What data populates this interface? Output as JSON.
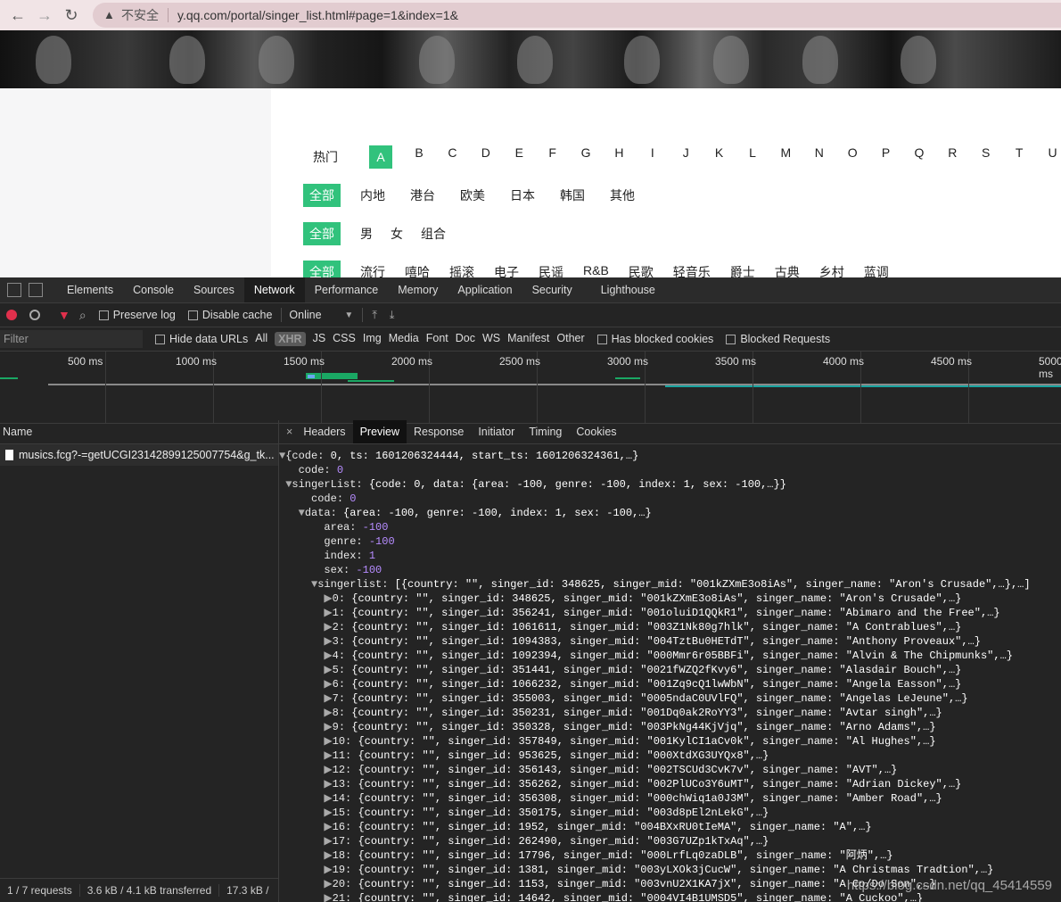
{
  "browser": {
    "insecure_label": "不安全",
    "url": "y.qq.com/portal/singer_list.html#page=1&index=1&"
  },
  "page": {
    "index_row": {
      "hot": "热门",
      "letters": [
        "A",
        "B",
        "C",
        "D",
        "E",
        "F",
        "G",
        "H",
        "I",
        "J",
        "K",
        "L",
        "M",
        "N",
        "O",
        "P",
        "Q",
        "R",
        "S",
        "T",
        "U"
      ],
      "active": "A"
    },
    "area_row": {
      "all": "全部",
      "items": [
        "内地",
        "港台",
        "欧美",
        "日本",
        "韩国",
        "其他"
      ]
    },
    "sex_row": {
      "all": "全部",
      "items": [
        "男",
        "女",
        "组合"
      ]
    },
    "genre_row": {
      "all": "全部",
      "items": [
        "流行",
        "嘻哈",
        "摇滚",
        "电子",
        "民谣",
        "R&B",
        "民歌",
        "轻音乐",
        "爵士",
        "古典",
        "乡村",
        "蓝调"
      ]
    }
  },
  "devtools": {
    "tabs": [
      "Elements",
      "Console",
      "Sources",
      "Network",
      "Performance",
      "Memory",
      "Application",
      "Security",
      "Lighthouse"
    ],
    "active_tab": "Network",
    "toolbar": {
      "preserve_log": "Preserve log",
      "disable_cache": "Disable cache",
      "throttle": "Online"
    },
    "filter": {
      "placeholder": "Filter",
      "hide_data_urls": "Hide data URLs",
      "types": [
        "All",
        "XHR",
        "JS",
        "CSS",
        "Img",
        "Media",
        "Font",
        "Doc",
        "WS",
        "Manifest",
        "Other"
      ],
      "has_blocked_cookies": "Has blocked cookies",
      "blocked_requests": "Blocked Requests"
    },
    "timeline_ticks": [
      "500 ms",
      "1000 ms",
      "1500 ms",
      "2000 ms",
      "2500 ms",
      "3000 ms",
      "3500 ms",
      "4000 ms",
      "4500 ms",
      "5000 ms"
    ],
    "name_header": "Name",
    "request_name": "musics.fcg?-=getUCGI23142899125007754&g_tk...",
    "status": {
      "requests": "1 / 7 requests",
      "transferred": "3.6 kB / 4.1 kB transferred",
      "resources": "17.3 kB /"
    },
    "detail_tabs": [
      "Headers",
      "Preview",
      "Response",
      "Initiator",
      "Timing",
      "Cookies"
    ],
    "detail_active": "Preview",
    "json_lines": [
      "▼{code: 0, ts: 1601206324444, start_ts: 1601206324361,…}",
      "   code: 0",
      " ▼singerList: {code: 0, data: {area: -100, genre: -100, index: 1, sex: -100,…}}",
      "     code: 0",
      "   ▼data: {area: -100, genre: -100, index: 1, sex: -100,…}",
      "       area: -100",
      "       genre: -100",
      "       index: 1",
      "       sex: -100",
      "     ▼singerlist: [{country: \"\", singer_id: 348625, singer_mid: \"001kZXmE3o8iAs\", singer_name: \"Aron's Crusade\",…},…]",
      "       ▶0: {country: \"\", singer_id: 348625, singer_mid: \"001kZXmE3o8iAs\", singer_name: \"Aron's Crusade\",…}",
      "       ▶1: {country: \"\", singer_id: 356241, singer_mid: \"001oluiD1QQkR1\", singer_name: \"Abimaro and the Free\",…}",
      "       ▶2: {country: \"\", singer_id: 1061611, singer_mid: \"003Z1Nk80g7hlk\", singer_name: \"A Contrablues\",…}",
      "       ▶3: {country: \"\", singer_id: 1094383, singer_mid: \"004TztBu0HETdT\", singer_name: \"Anthony Proveaux\",…}",
      "       ▶4: {country: \"\", singer_id: 1092394, singer_mid: \"000Mmr6r05BBFi\", singer_name: \"Alvin & The Chipmunks\",…}",
      "       ▶5: {country: \"\", singer_id: 351441, singer_mid: \"0021fWZQ2fKvy6\", singer_name: \"Alasdair Bouch\",…}",
      "       ▶6: {country: \"\", singer_id: 1066232, singer_mid: \"001Zq9cQ1lwWbN\", singer_name: \"Angela Easson\",…}",
      "       ▶7: {country: \"\", singer_id: 355003, singer_mid: \"0005ndaC0UVlFQ\", singer_name: \"Angelas LeJeune\",…}",
      "       ▶8: {country: \"\", singer_id: 350231, singer_mid: \"001Dq0ak2RoYY3\", singer_name: \"Avtar singh\",…}",
      "       ▶9: {country: \"\", singer_id: 350328, singer_mid: \"003PkNg44KjVjq\", singer_name: \"Arno Adams\",…}",
      "       ▶10: {country: \"\", singer_id: 357849, singer_mid: \"001KylCI1aCv0k\", singer_name: \"Al Hughes\",…}",
      "       ▶11: {country: \"\", singer_id: 953625, singer_mid: \"000XtdXG3UYQx8\",…}",
      "       ▶12: {country: \"\", singer_id: 356143, singer_mid: \"002TSCUd3CvK7v\", singer_name: \"AVT\",…}",
      "       ▶13: {country: \"\", singer_id: 356262, singer_mid: \"002PlUCo3Y6uMT\", singer_name: \"Adrian Dickey\",…}",
      "       ▶14: {country: \"\", singer_id: 356308, singer_mid: \"000chWiq1a0J3M\", singer_name: \"Amber Road\",…}",
      "       ▶15: {country: \"\", singer_id: 350175, singer_mid: \"003d8pEl2nLekG\",…}",
      "       ▶16: {country: \"\", singer_id: 1952, singer_mid: \"004BXxRU0tIeMA\", singer_name: \"A\",…}",
      "       ▶17: {country: \"\", singer_id: 262490, singer_mid: \"003G7UZp1kTxAq\",…}",
      "       ▶18: {country: \"\", singer_id: 17796, singer_mid: \"000LrfLq0zaDLB\", singer_name: \"阿炳\",…}",
      "       ▶19: {country: \"\", singer_id: 1381, singer_mid: \"003yLXOk3jCucW\", singer_name: \"A Christmas Tradtion\",…}",
      "       ▶20: {country: \"\", singer_id: 1153, singer_mid: \"003vnU2X1KA7jX\", singer_name: \"A Co/Do Son\",…}",
      "       ▶21: {country: \"\", singer_id: 14642, singer_mid: \"0004VI4B1UMSD5\", singer_name: \"A Cuckoo\",…}"
    ],
    "watermark": "https://blog.csdn.net/qq_45414559"
  }
}
